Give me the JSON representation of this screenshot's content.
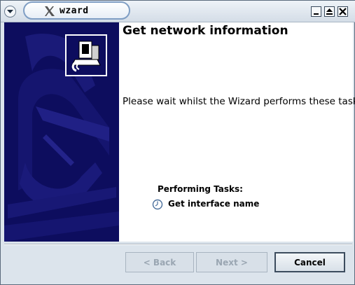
{
  "window": {
    "title": "wzard"
  },
  "page": {
    "title": "Get network information",
    "description": "Please wait whilst the Wizard performs these tasks."
  },
  "tasks": {
    "label": "Performing Tasks:",
    "items": [
      {
        "name": "Get interface name",
        "icon": "clock-icon"
      }
    ]
  },
  "buttons": {
    "back": "< Back",
    "next": "Next >",
    "cancel": "Cancel"
  },
  "colors": {
    "side_panel": "#0d0d5e",
    "accent": "#7f9ec4"
  }
}
